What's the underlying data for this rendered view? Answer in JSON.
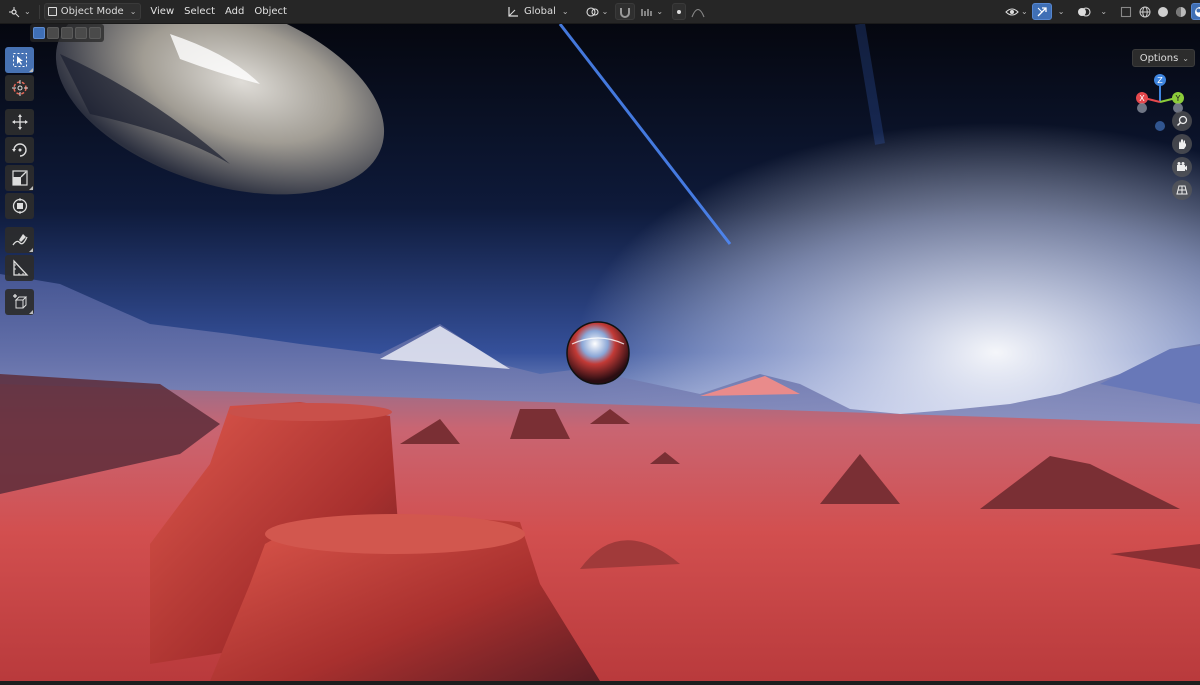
{
  "header": {
    "editor_type_icon": "3d-viewport-icon",
    "mode_label": "Object Mode",
    "menus": [
      "View",
      "Select",
      "Add",
      "Object"
    ],
    "orientation_label": "Global"
  },
  "viewport": {
    "options_label": "Options",
    "gizmo": {
      "x_label": "X",
      "y_label": "Y",
      "z_label": "Z"
    }
  },
  "toolbar": {
    "tools": [
      "select-box",
      "cursor",
      "move",
      "rotate",
      "scale",
      "transform",
      "annotate",
      "measure",
      "add-cube"
    ]
  },
  "colors": {
    "accent": "#4772b3",
    "x_axis": "#e5484d",
    "y_axis": "#8ccc3a",
    "z_axis": "#3f86e0"
  }
}
